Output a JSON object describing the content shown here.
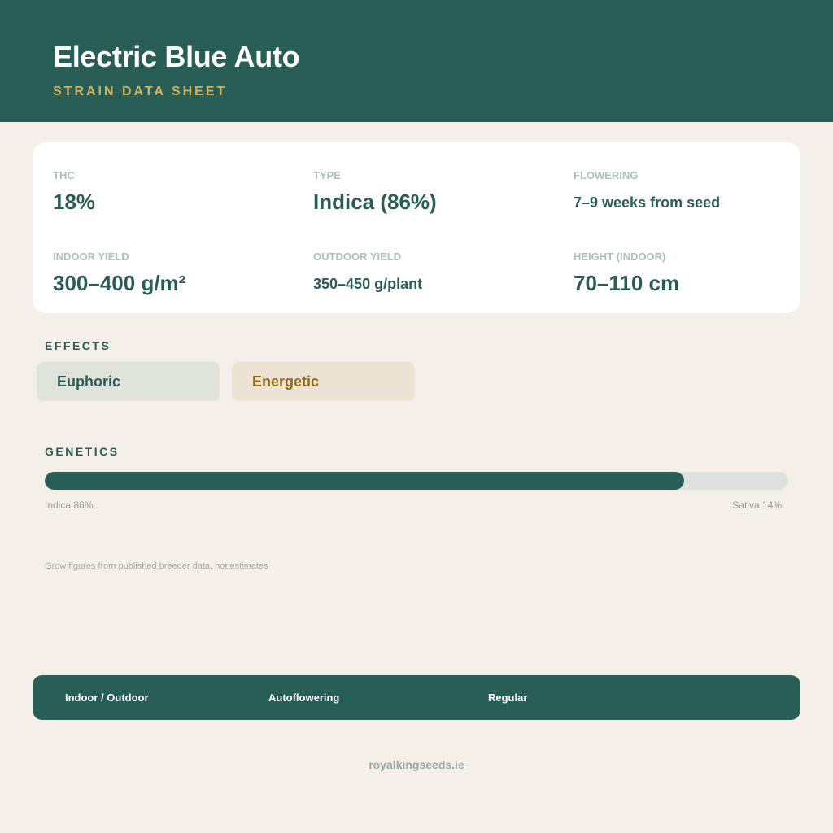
{
  "header": {
    "title": "Electric Blue Auto",
    "subtitle": "STRAIN DATA SHEET"
  },
  "stats": [
    {
      "label": "THC",
      "value": "18%"
    },
    {
      "label": "TYPE",
      "value": "Indica (86%)"
    },
    {
      "label": "FLOWERING",
      "value": "7–9 weeks from seed"
    },
    {
      "label": "INDOOR YIELD",
      "value": "300–400 g/m²"
    },
    {
      "label": "OUTDOOR YIELD",
      "value": "350–450 g/plant"
    },
    {
      "label": "HEIGHT (INDOOR)",
      "value": "70–110 cm"
    }
  ],
  "effects": {
    "title": "EFFECTS",
    "items": [
      "Euphoric",
      "Energetic"
    ]
  },
  "genetics": {
    "title": "GENETICS",
    "indica_percent": 86,
    "indica_label": "Indica 86%",
    "sativa_label": "Sativa 14%"
  },
  "note": "Grow figures from published breeder data, not estimates",
  "footer": {
    "items": [
      "Indoor / Outdoor",
      "Autoflowering",
      "Regular"
    ],
    "site": "royalkingseeds.ie"
  },
  "colors": {
    "primary": "#285e56",
    "accent_gold": "#d1b25c",
    "background": "#f4efe8",
    "effect_energetic_text": "#926a18"
  }
}
